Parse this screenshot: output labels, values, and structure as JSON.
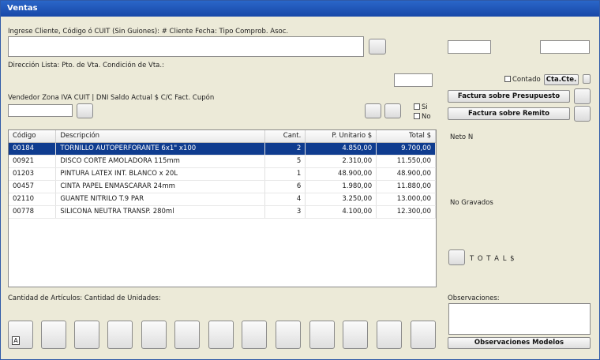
{
  "window": {
    "title": "Ventas"
  },
  "labels": {
    "cliente": "Ingrese Cliente, Código ó CUIT (Sin Guiones): # Cliente Fecha: Tipo Comprob. Asoc.",
    "direccion": "Dirección Lista: Pto. de Vta. Condición de Vta.:",
    "vendedor": "Vendedor Zona IVA CUIT | DNI Saldo Actual $ C/C Fact. Cupón",
    "neto": "Neto N",
    "no_gravados": "No Gravados",
    "totals": "T O T A L $",
    "cantidades": "Cantidad de Artículos: Cantidad de Unidades:",
    "observaciones": "Observaciones:"
  },
  "checks": {
    "si": "Si",
    "no": "No",
    "contado": "Contado"
  },
  "buttons": {
    "cta_cte": "Cta.Cte.",
    "factura_presupuesto": "Factura sobre Presupuesto",
    "factura_remito": "Factura sobre Remito",
    "obs_modelos": "Observaciones Modelos",
    "first_tag": "A"
  },
  "grid": {
    "headers": {
      "codigo": "Código",
      "descripcion": "Descripción",
      "cant": "Cant.",
      "unit": "P. Unitario $",
      "total": "Total $"
    },
    "rows": [
      {
        "codigo": "00184",
        "descripcion": "TORNILLO AUTOPERFORANTE 6x1\" x100",
        "cant": "2",
        "unit": "4.850,00",
        "total": "9.700,00"
      },
      {
        "codigo": "00921",
        "descripcion": "DISCO CORTE AMOLADORA 115mm",
        "cant": "5",
        "unit": "2.310,00",
        "total": "11.550,00"
      },
      {
        "codigo": "01203",
        "descripcion": "PINTURA LATEX INT. BLANCO x 20L",
        "cant": "1",
        "unit": "48.900,00",
        "total": "48.900,00"
      },
      {
        "codigo": "00457",
        "descripcion": "CINTA PAPEL ENMASCARAR 24mm",
        "cant": "6",
        "unit": "1.980,00",
        "total": "11.880,00"
      },
      {
        "codigo": "02110",
        "descripcion": "GUANTE NITRILO T.9 PAR",
        "cant": "4",
        "unit": "3.250,00",
        "total": "13.000,00"
      },
      {
        "codigo": "00778",
        "descripcion": "SILICONA NEUTRA TRANSP. 280ml",
        "cant": "3",
        "unit": "4.100,00",
        "total": "12.300,00"
      }
    ]
  }
}
